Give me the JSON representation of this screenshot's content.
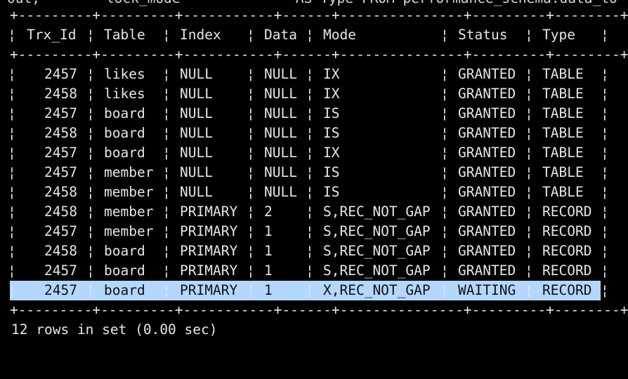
{
  "terminal": {
    "partial_top_line": "out;        lock_mode              AS Type FROM performance_schema.data_lo",
    "border_line": "+---------+---------+-----------+------+---------------+---------+--------+",
    "headers": [
      "Trx_Id",
      "Table",
      "Index",
      "Data",
      "Mode",
      "Status",
      "Type"
    ],
    "rows": [
      [
        "2457",
        "likes",
        "NULL",
        "NULL",
        "IX",
        "GRANTED",
        "TABLE"
      ],
      [
        "2458",
        "likes",
        "NULL",
        "NULL",
        "IX",
        "GRANTED",
        "TABLE"
      ],
      [
        "2457",
        "board",
        "NULL",
        "NULL",
        "IS",
        "GRANTED",
        "TABLE"
      ],
      [
        "2458",
        "board",
        "NULL",
        "NULL",
        "IS",
        "GRANTED",
        "TABLE"
      ],
      [
        "2457",
        "board",
        "NULL",
        "NULL",
        "IX",
        "GRANTED",
        "TABLE"
      ],
      [
        "2457",
        "member",
        "NULL",
        "NULL",
        "IS",
        "GRANTED",
        "TABLE"
      ],
      [
        "2458",
        "member",
        "NULL",
        "NULL",
        "IS",
        "GRANTED",
        "TABLE"
      ],
      [
        "2458",
        "member",
        "PRIMARY",
        "2",
        "S,REC_NOT_GAP",
        "GRANTED",
        "RECORD"
      ],
      [
        "2457",
        "member",
        "PRIMARY",
        "1",
        "S,REC_NOT_GAP",
        "GRANTED",
        "RECORD"
      ],
      [
        "2458",
        "board",
        "PRIMARY",
        "1",
        "S,REC_NOT_GAP",
        "GRANTED",
        "RECORD"
      ],
      [
        "2457",
        "board",
        "PRIMARY",
        "1",
        "S,REC_NOT_GAP",
        "GRANTED",
        "RECORD"
      ],
      [
        "2457",
        "board",
        "PRIMARY",
        "1",
        "X,REC_NOT_GAP",
        "WAITING",
        "RECORD"
      ]
    ],
    "highlighted_row_index": 11,
    "footer": "12 rows in set (0.00 sec)",
    "colors": {
      "background": "#000000",
      "text": "#e6e6e6",
      "highlight": "#b4d7ff"
    }
  }
}
